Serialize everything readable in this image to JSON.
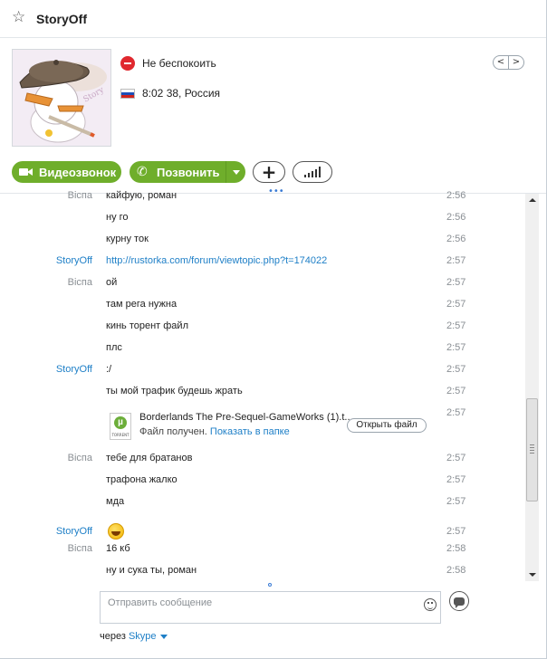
{
  "header": {
    "title": "StoryOff",
    "star_icon": "star-icon"
  },
  "profile": {
    "status": "Не беспокоить",
    "local_time_location": "8:02 38, Россия",
    "nav_prev": "<",
    "nav_next": ">"
  },
  "actions": {
    "video_call_label": "Видеозвонок",
    "call_label": "Позвонить",
    "add_label": "+"
  },
  "chat": {
    "messages": [
      {
        "sender": "Віспа",
        "text": "кайфую, роман",
        "time": "2:56"
      },
      {
        "sender": "",
        "text": "ну го",
        "time": "2:56"
      },
      {
        "sender": "",
        "text": "курну ток",
        "time": "2:56"
      },
      {
        "sender": "StoryOff",
        "text": "http://rustorka.com/forum/viewtopic.php?t=174022",
        "time": "2:57"
      },
      {
        "sender": "Віспа",
        "text": "ой",
        "time": "2:57"
      },
      {
        "sender": "",
        "text": "там рега нужна",
        "time": "2:57"
      },
      {
        "sender": "",
        "text": "кинь торент файл",
        "time": "2:57"
      },
      {
        "sender": "",
        "text": "плс",
        "time": "2:57"
      },
      {
        "sender": "StoryOff",
        "text": ":/",
        "time": "2:57"
      },
      {
        "sender": "",
        "text": "ты мой трафик будешь жрать",
        "time": "2:57"
      },
      {
        "sender": "",
        "text": "",
        "time": "2:57"
      },
      {
        "sender": "Віспа",
        "text": "тебе для братанов",
        "time": "2:57"
      },
      {
        "sender": "",
        "text": "трафона жалко",
        "time": "2:57"
      },
      {
        "sender": "",
        "text": "мда",
        "time": "2:57"
      },
      {
        "sender": "StoryOff",
        "text": "",
        "time": "2:57"
      },
      {
        "sender": "Віспа",
        "text": "16 кб",
        "time": "2:58"
      },
      {
        "sender": "",
        "text": "ну и сука ты, роман",
        "time": "2:58"
      }
    ],
    "file": {
      "name": "Borderlands The Pre-Sequel-GameWorks (1).t...",
      "status_prefix": "Файл получен.",
      "show_in_folder": "Показать в папке",
      "open_button": "Открыть файл",
      "icon_label": "TORRENT"
    }
  },
  "composer": {
    "placeholder": "Отправить сообщение",
    "via_prefix": "через",
    "via_service": "Skype"
  },
  "colors": {
    "accent_green": "#6fae2b",
    "link_blue": "#1e7fc7",
    "dnd_red": "#e0282e"
  }
}
